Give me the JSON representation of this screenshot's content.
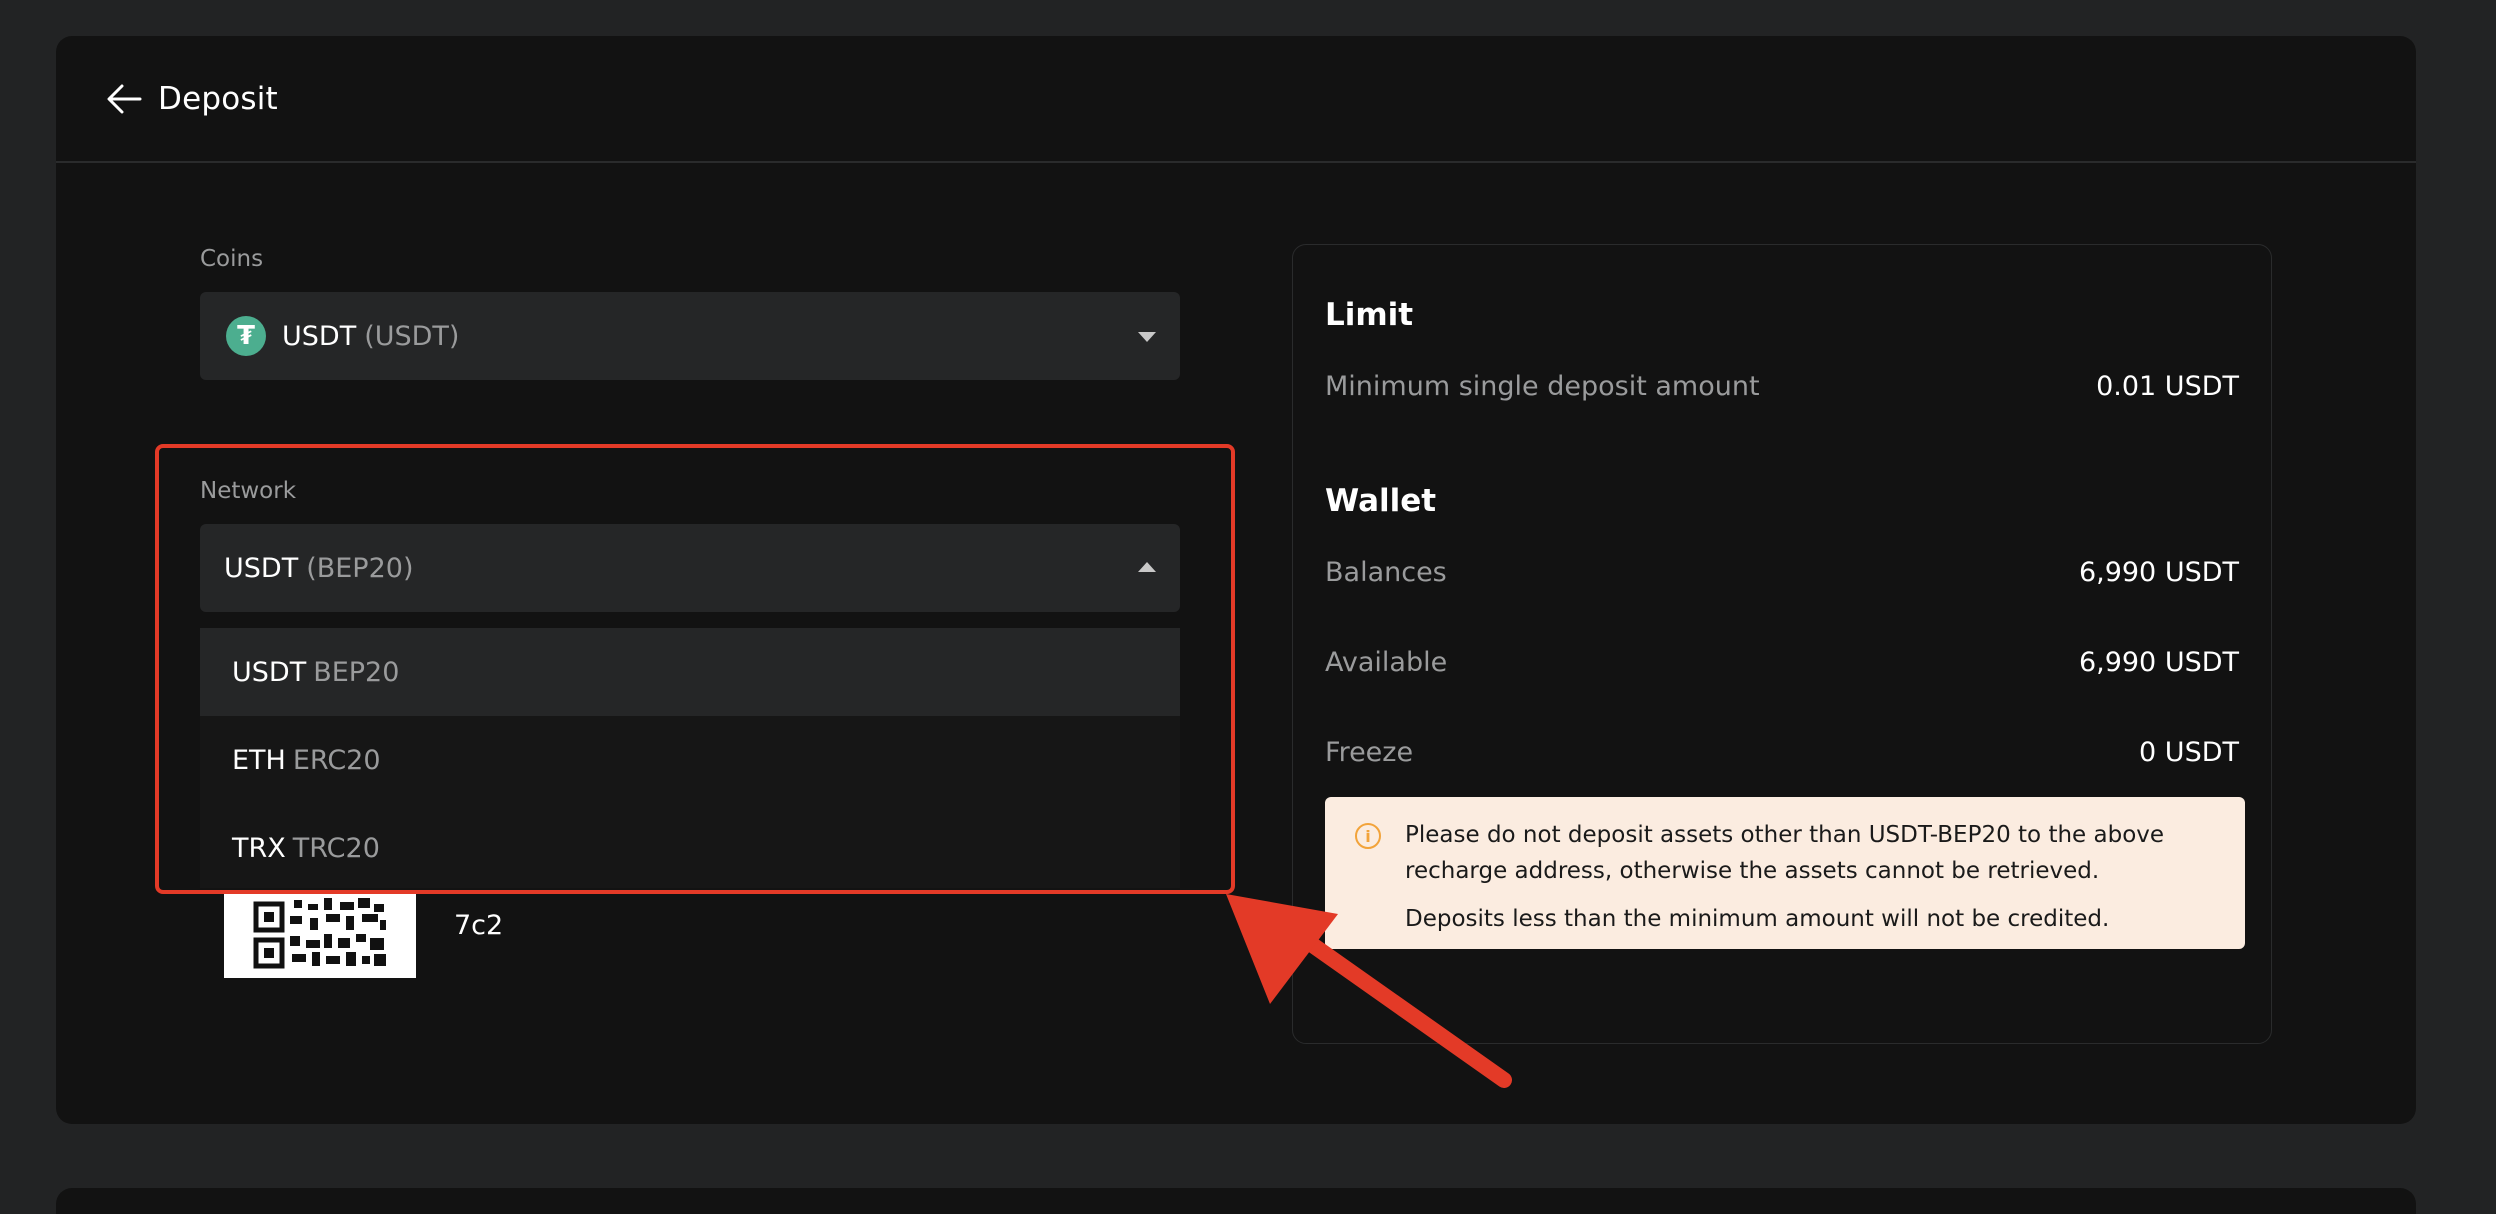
{
  "header": {
    "title": "Deposit"
  },
  "coins": {
    "label": "Coins",
    "selected_main": "USDT",
    "selected_sub": "(USDT)",
    "logo_glyph": "₮",
    "logo_color": "#4cae8f"
  },
  "network": {
    "label": "Network",
    "selected_main": "USDT",
    "selected_sub": "(BEP20)",
    "options": [
      {
        "main": "USDT",
        "sub": "BEP20"
      },
      {
        "main": "ETH",
        "sub": "ERC20"
      },
      {
        "main": "TRX",
        "sub": "TRC20"
      }
    ]
  },
  "address": {
    "text_partial": "7c2"
  },
  "limit": {
    "title": "Limit",
    "min_label": "Minimum single deposit amount",
    "min_value": "0.01 USDT"
  },
  "wallet": {
    "title": "Wallet",
    "balances_label": "Balances",
    "balances_value": "6,990 USDT",
    "available_label": "Available",
    "available_value": "6,990 USDT",
    "freeze_label": "Freeze",
    "freeze_value": "0 USDT"
  },
  "notice": {
    "icon": "i",
    "line1": "Please do not deposit assets other than USDT-BEP20 to the above recharge address, otherwise the assets cannot be retrieved.",
    "line2": "Deposits less than the minimum amount will not be credited."
  },
  "colors": {
    "annotation_red": "#e33a27",
    "notice_bg": "#fbece0",
    "notice_icon": "#f2a33a"
  }
}
